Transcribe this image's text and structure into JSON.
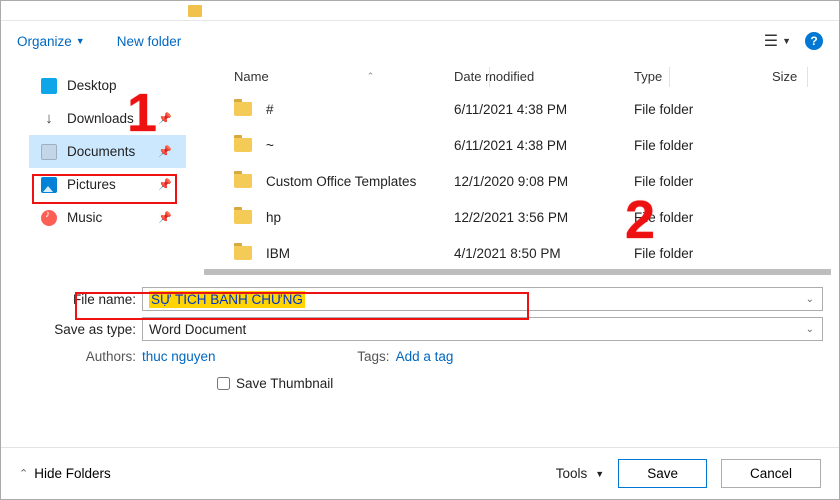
{
  "toolbar": {
    "organize": "Organize",
    "new_folder": "New folder"
  },
  "sidebar": {
    "items": [
      {
        "label": "Desktop"
      },
      {
        "label": "Downloads"
      },
      {
        "label": "Documents"
      },
      {
        "label": "Pictures"
      },
      {
        "label": "Music"
      }
    ]
  },
  "columns": {
    "name": "Name",
    "date": "Date modified",
    "type": "Type",
    "size": "Size"
  },
  "files": [
    {
      "name": "#",
      "date": "6/11/2021 4:38 PM",
      "type": "File folder"
    },
    {
      "name": "~",
      "date": "6/11/2021 4:38 PM",
      "type": "File folder"
    },
    {
      "name": "Custom Office Templates",
      "date": "12/1/2020 9:08 PM",
      "type": "File folder"
    },
    {
      "name": "hp",
      "date": "12/2/2021 3:56 PM",
      "type": "File folder"
    },
    {
      "name": "IBM",
      "date": "4/1/2021 8:50 PM",
      "type": "File folder"
    }
  ],
  "form": {
    "filename_label": "File name:",
    "filename_value": "SỰ TÍCH BÁNH CHƯNG",
    "saveastype_label": "Save as type:",
    "saveastype_value": "Word Document",
    "authors_label": "Authors:",
    "authors_value": "thuc nguyen",
    "tags_label": "Tags:",
    "tags_value": "Add a tag",
    "save_thumbnail": "Save Thumbnail"
  },
  "bottom": {
    "hide_folders": "Hide Folders",
    "tools": "Tools",
    "save": "Save",
    "cancel": "Cancel"
  },
  "annotations": {
    "one": "1",
    "two": "2"
  }
}
